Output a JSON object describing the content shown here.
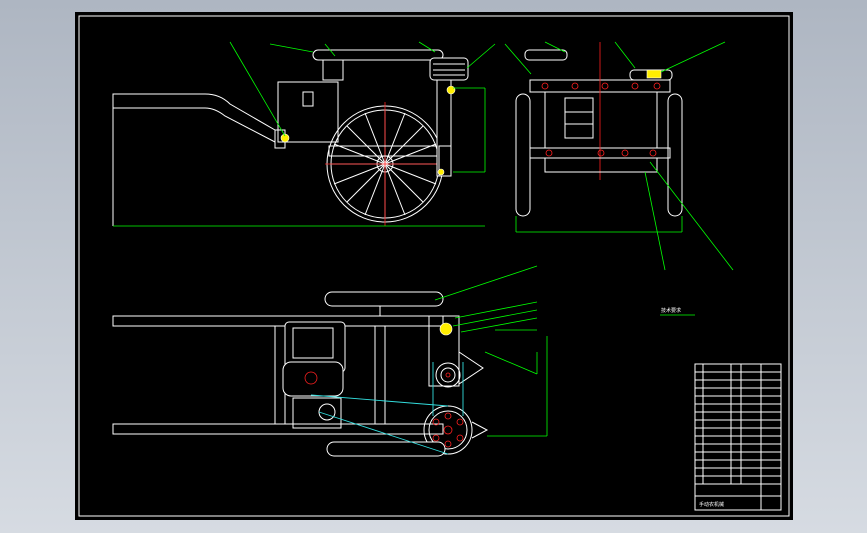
{
  "sheet": {
    "note": "技术要求",
    "title_block": "手动农机械"
  },
  "colors": {
    "background": "#000000",
    "outline": "#ffffff",
    "leader": "#00ff00",
    "centerline": "#ff2020",
    "belt": "#33dddd",
    "highlight": "#ffee00"
  }
}
